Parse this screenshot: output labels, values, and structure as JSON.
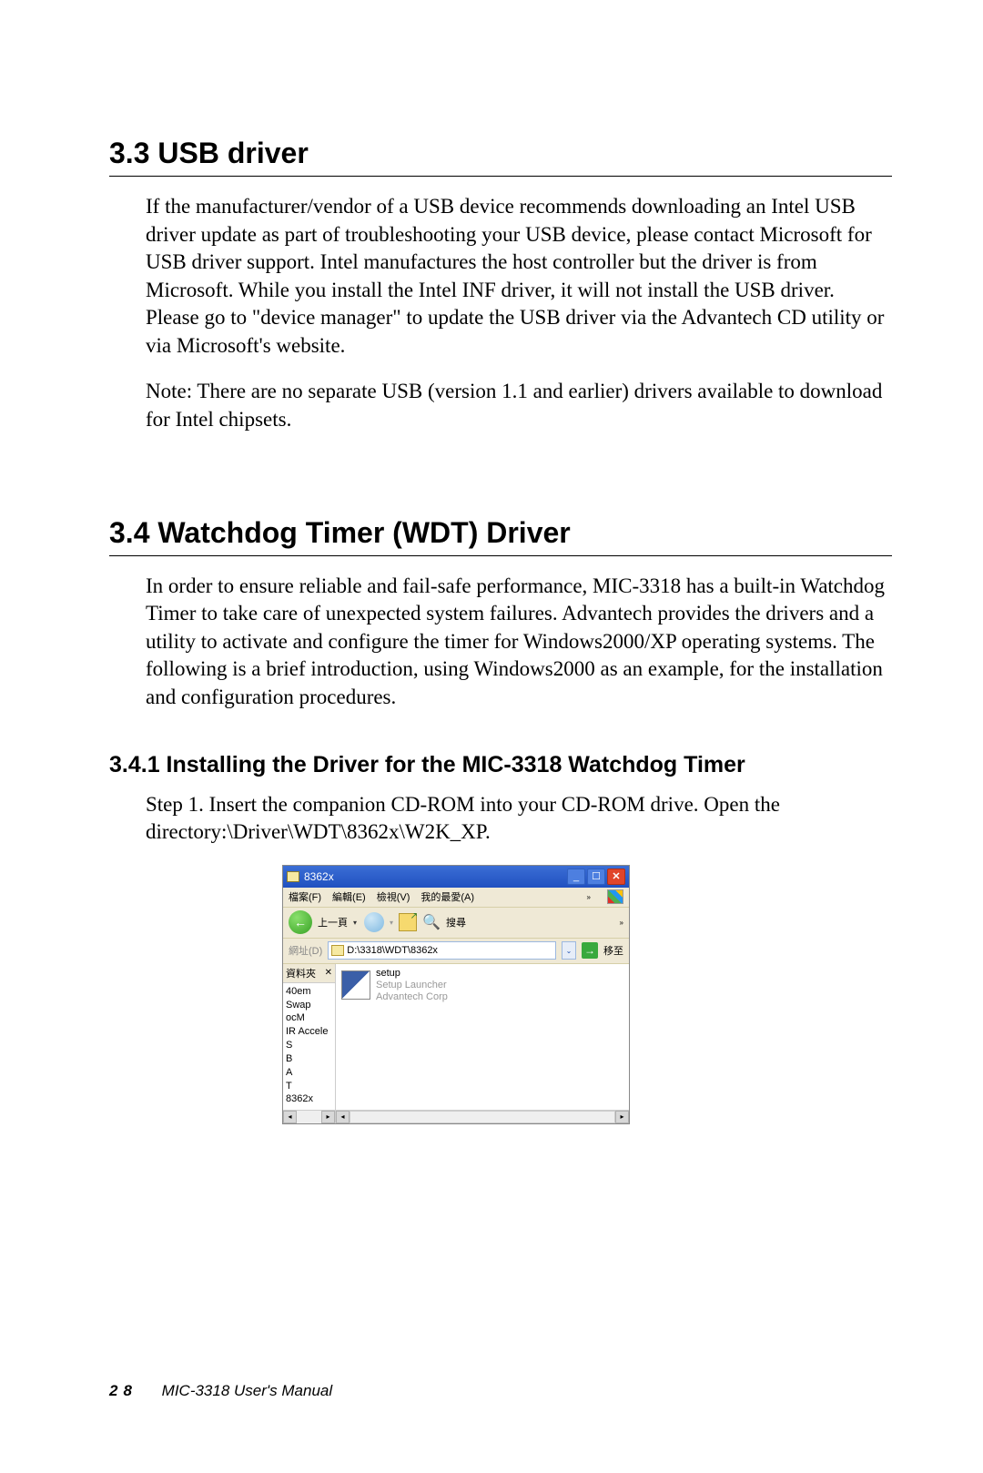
{
  "section33": {
    "heading": "3.3 USB driver",
    "p1": "If the manufacturer/vendor of a USB device recommends downloading an Intel USB driver update as part of troubleshooting your USB device, please contact Microsoft for USB driver support. Intel manufactures the host controller but the driver is from Microsoft. While you install the Intel INF driver, it will not install the USB driver. Please go to \"device manager\" to update the USB driver via the Advantech CD utility or via Microsoft's website.",
    "p2": "Note: There are no separate USB (version 1.1 and earlier) drivers available to download for Intel chipsets."
  },
  "section34": {
    "heading": "3.4 Watchdog Timer (WDT) Driver",
    "p1": "In order to ensure reliable and fail-safe performance, MIC-3318 has a built-in Watchdog Timer to take care of unexpected system failures. Advantech provides the drivers and a utility to activate and configure the timer for Windows2000/XP operating systems. The following is a brief introduction, using Windows2000 as an example, for the installation and configuration procedures."
  },
  "section341": {
    "heading": "3.4.1 Installing the Driver for the MIC-3318 Watchdog Timer",
    "p1": "Step 1. Insert the companion CD-ROM into your CD-ROM drive. Open the directory:\\Driver\\WDT\\8362x\\W2K_XP."
  },
  "screenshot": {
    "title": "8362x",
    "menu": {
      "file": "檔案(F)",
      "edit": "編輯(E)",
      "view": "檢視(V)",
      "fav": "我的最愛(A)"
    },
    "toolbar": {
      "back": "上一頁",
      "search": "搜尋"
    },
    "addr": {
      "label": "網址(D)",
      "path": "D:\\3318\\WDT\\8362x",
      "go": "移至"
    },
    "sidebar": {
      "header": "資料夾",
      "items": [
        "40em",
        "Swap",
        "ocM",
        "",
        "IR Accele",
        "S",
        "B",
        "A",
        "T",
        "8362x"
      ]
    },
    "file": {
      "name": "setup",
      "desc1": "Setup Launcher",
      "desc2": "Advantech Corp"
    }
  },
  "footer": {
    "page": "28",
    "manual": "MIC-3318 User's Manual"
  }
}
